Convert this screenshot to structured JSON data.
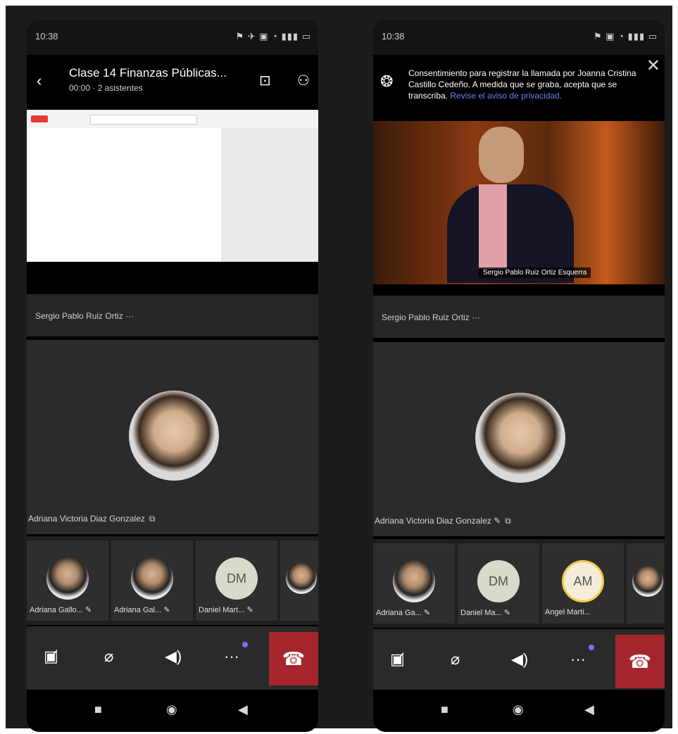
{
  "left": {
    "status": {
      "time": "10:38",
      "icons": "⚑ ✈ ▣ ◔ ▮▮▮ ▭"
    },
    "header": {
      "title": "Clase 14 Finanzas Públicas...",
      "subtitle": "00:00 · 2 asistentes",
      "back": "‹",
      "chat_icon": "⊡",
      "people_icon": "⚇"
    },
    "share_caption": "",
    "presenter_name": "Sergio Pablo Ruiz Ortiz ···",
    "main_participant": {
      "name": "Adriana Victoria Diaz Gonzalez",
      "pin": "⧉"
    },
    "thumbs": [
      {
        "type": "photo",
        "label": "Adriana Gallo... ✎"
      },
      {
        "type": "photo",
        "label": "Adriana Gal... ✎"
      },
      {
        "type": "initial",
        "initials": "DM",
        "label": "Daniel Mart... ✎"
      },
      {
        "type": "photo",
        "label": ""
      }
    ],
    "controls": {
      "camera": "▣̸",
      "mic": "⌀",
      "speaker": "◀)",
      "more": "···",
      "hangup": "☎"
    },
    "nav": {
      "square": "■",
      "home": "◉",
      "back": "◀"
    }
  },
  "right": {
    "status": {
      "time": "10:38",
      "icons": "⚑ ▣ ◔ ▮▮▮ ▭"
    },
    "banner": {
      "icon": "❂",
      "text": "Consentimiento para registrar la llamada por Joanna Cristina Castillo Cedeño. A medida que se graba, acepta que se transcriba. ",
      "link": "Revise el aviso de privacidad.",
      "close": "✕"
    },
    "video_caption": "Sergio Pablo Ruiz Ortiz Esquerra",
    "presenter_name": "Sergio Pablo Ruiz Ortiz ···",
    "main_participant": {
      "name": "Adriana Victoria Diaz Gonzalez ✎",
      "pin": "⧉"
    },
    "thumbs": [
      {
        "type": "photo",
        "label": "Adriana Ga... ✎"
      },
      {
        "type": "initial",
        "initials": "DM",
        "label": "Daniel Ma... ✎"
      },
      {
        "type": "initial-am",
        "initials": "AM",
        "label": "Angel Marti..."
      },
      {
        "type": "photo",
        "label": ""
      }
    ],
    "controls": {
      "camera": "▣̸",
      "mic": "⌀",
      "speaker": "◀)",
      "more": "···",
      "hangup": "☎"
    },
    "nav": {
      "square": "■",
      "home": "◉",
      "back": "◀"
    }
  },
  "colors": {
    "hangup": "#a4262c",
    "accent": "#6a74ff",
    "tile_bg": "#2b2b2b"
  }
}
